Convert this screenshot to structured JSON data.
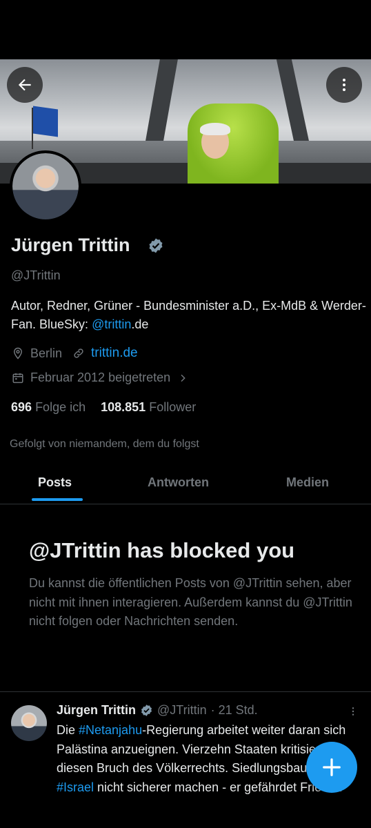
{
  "profile": {
    "name": "Jürgen Trittin",
    "handle": "@JTrittin",
    "bio_text": "Autor, Redner, Grüner - Bundesminister a.D., Ex-MdB & Werder-Fan. BlueSky: ",
    "bio_link": "@trittin",
    "bio_suffix": ".de",
    "location": "Berlin",
    "website": "trittin.de",
    "joined": "Februar 2012 beigetreten",
    "following_count": "696",
    "following_label": "Folge ich",
    "followers_count": "108.851",
    "followers_label": "Follower",
    "followed_by": "Gefolgt von niemandem, dem du folgst"
  },
  "tabs": [
    {
      "label": "Posts",
      "active": true
    },
    {
      "label": "Antworten",
      "active": false
    },
    {
      "label": "Medien",
      "active": false
    }
  ],
  "blocked": {
    "title": "@JTrittin has blocked you",
    "text": "Du kannst die öffentlichen Posts von @JTrittin sehen, aber nicht mit ihnen interagieren. Außerdem kannst du @JTrittin nicht folgen oder Nachrichten senden."
  },
  "tweet": {
    "name": "Jürgen Trittin",
    "handle": "@JTrittin",
    "time": "· 21 Std.",
    "text_1": "Die ",
    "tag_1": "#Netanjahu",
    "text_2": "-Regierung arbeitet weiter daran sich Palästina anzueignen. Vierzehn Staaten kritisieren diesen Bruch des Völkerrechts. Siedlungsbau wird ",
    "tag_2": "#Israel",
    "text_3": " nicht sicherer machen - er gefährdet Frieden"
  },
  "icons": {
    "back": "arrow-left-icon",
    "more": "more-vertical-icon",
    "verified": "verified-badge-icon",
    "location": "location-pin-icon",
    "link": "link-icon",
    "calendar": "calendar-icon",
    "chevron": "chevron-right-icon",
    "compose": "plus-icon"
  },
  "colors": {
    "background": "#000000",
    "accent": "#1d9bf0",
    "text_primary": "#e7e9ea",
    "text_secondary": "#71767b",
    "verified_badge": "#829aab"
  }
}
